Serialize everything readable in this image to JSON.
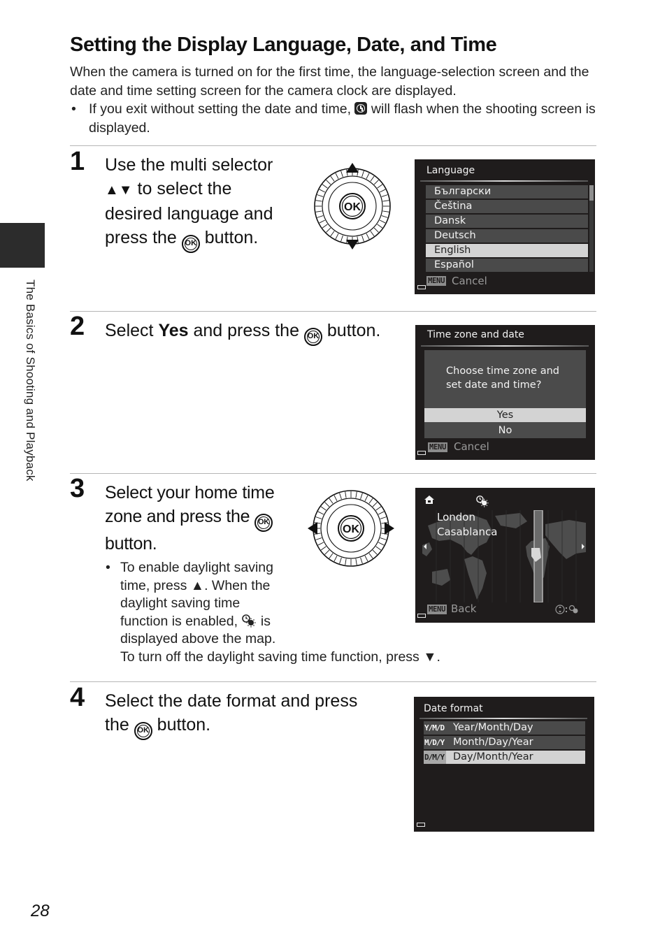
{
  "page": {
    "title": "Setting the Display Language, Date, and Time",
    "intro": "When the camera is turned on for the first time, the language-selection screen and the date and time setting screen for the camera clock are displayed.",
    "bullet_before_icon": "If you exit without setting the date and time,",
    "bullet_icon": "clock-warning-icon",
    "bullet_after_icon": "will flash when the shooting screen is displayed.",
    "side_tab_label": "The Basics of Shooting and Playback",
    "page_number": "28"
  },
  "steps": [
    {
      "number": "1",
      "line1": "Use the multi selector",
      "line2_symbols": "▲▼",
      "line2": " to select the",
      "line3": "desired language and",
      "line4_before": "press the",
      "line4_ok": "OK",
      "line4_after": "button.",
      "dial_icon": "multi-selector-up-down-icon",
      "screen": {
        "title": "Language",
        "items": [
          {
            "label": "Български",
            "selected": false
          },
          {
            "label": "Čeština",
            "selected": false
          },
          {
            "label": "Dansk",
            "selected": false
          },
          {
            "label": "Deutsch",
            "selected": false
          },
          {
            "label": "English",
            "selected": true
          },
          {
            "label": "Español",
            "selected": false
          }
        ],
        "menu_badge": "MENU",
        "footer": "Cancel",
        "scroll_position": 0.0,
        "scroll_visible_fraction": 0.12
      }
    },
    {
      "number": "2",
      "text_before": "Select ",
      "text_bold": "Yes",
      "text_middle": " and press the",
      "text_ok": "OK",
      "text_after": "button.",
      "screen": {
        "title": "Time zone and date",
        "question_line1": "Choose time zone and",
        "question_line2": "set date and time?",
        "options": [
          {
            "label": "Yes",
            "selected": true
          },
          {
            "label": "No",
            "selected": false
          }
        ],
        "menu_badge": "MENU",
        "footer": "Cancel"
      }
    },
    {
      "number": "3",
      "line1": "Select your home time",
      "line2_before": "zone and press the",
      "line2_ok": "OK",
      "line3": "button.",
      "dial_icon": "multi-selector-left-right-icon",
      "sub_line1": "To enable daylight saving",
      "sub_line2_before": "time, press ",
      "sub_line2_symbol": "▲",
      "sub_line2_after": ". When the",
      "sub_line3": "daylight saving time",
      "sub_line4_before": "function is enabled,",
      "sub_line4_icon": "daylight-saving-icon",
      "sub_line4_after": "is",
      "sub_line5": "displayed above the map.",
      "sub_line6_before": "To turn off the daylight saving time function, press ",
      "sub_line6_symbol": "▼",
      "sub_line6_after": ".",
      "screen": {
        "home_icon": "home-icon",
        "dst_icon": "daylight-saving-icon",
        "city1": "London",
        "city2": "Casablanca",
        "menu_badge": "MENU",
        "footer": "Back",
        "hint_icon": "multi-selector-icon",
        "hint_sep": ":"
      }
    },
    {
      "number": "4",
      "line1": "Select the date format and press",
      "line2_before": "the",
      "line2_ok": "OK",
      "line2_after": "button.",
      "screen": {
        "title": "Date format",
        "items": [
          {
            "code": "Y/M/D",
            "label": "Year/Month/Day",
            "selected": false
          },
          {
            "code": "M/D/Y",
            "label": "Month/Day/Year",
            "selected": false
          },
          {
            "code": "D/M/Y",
            "label": "Day/Month/Year",
            "selected": true
          }
        ]
      }
    }
  ]
}
